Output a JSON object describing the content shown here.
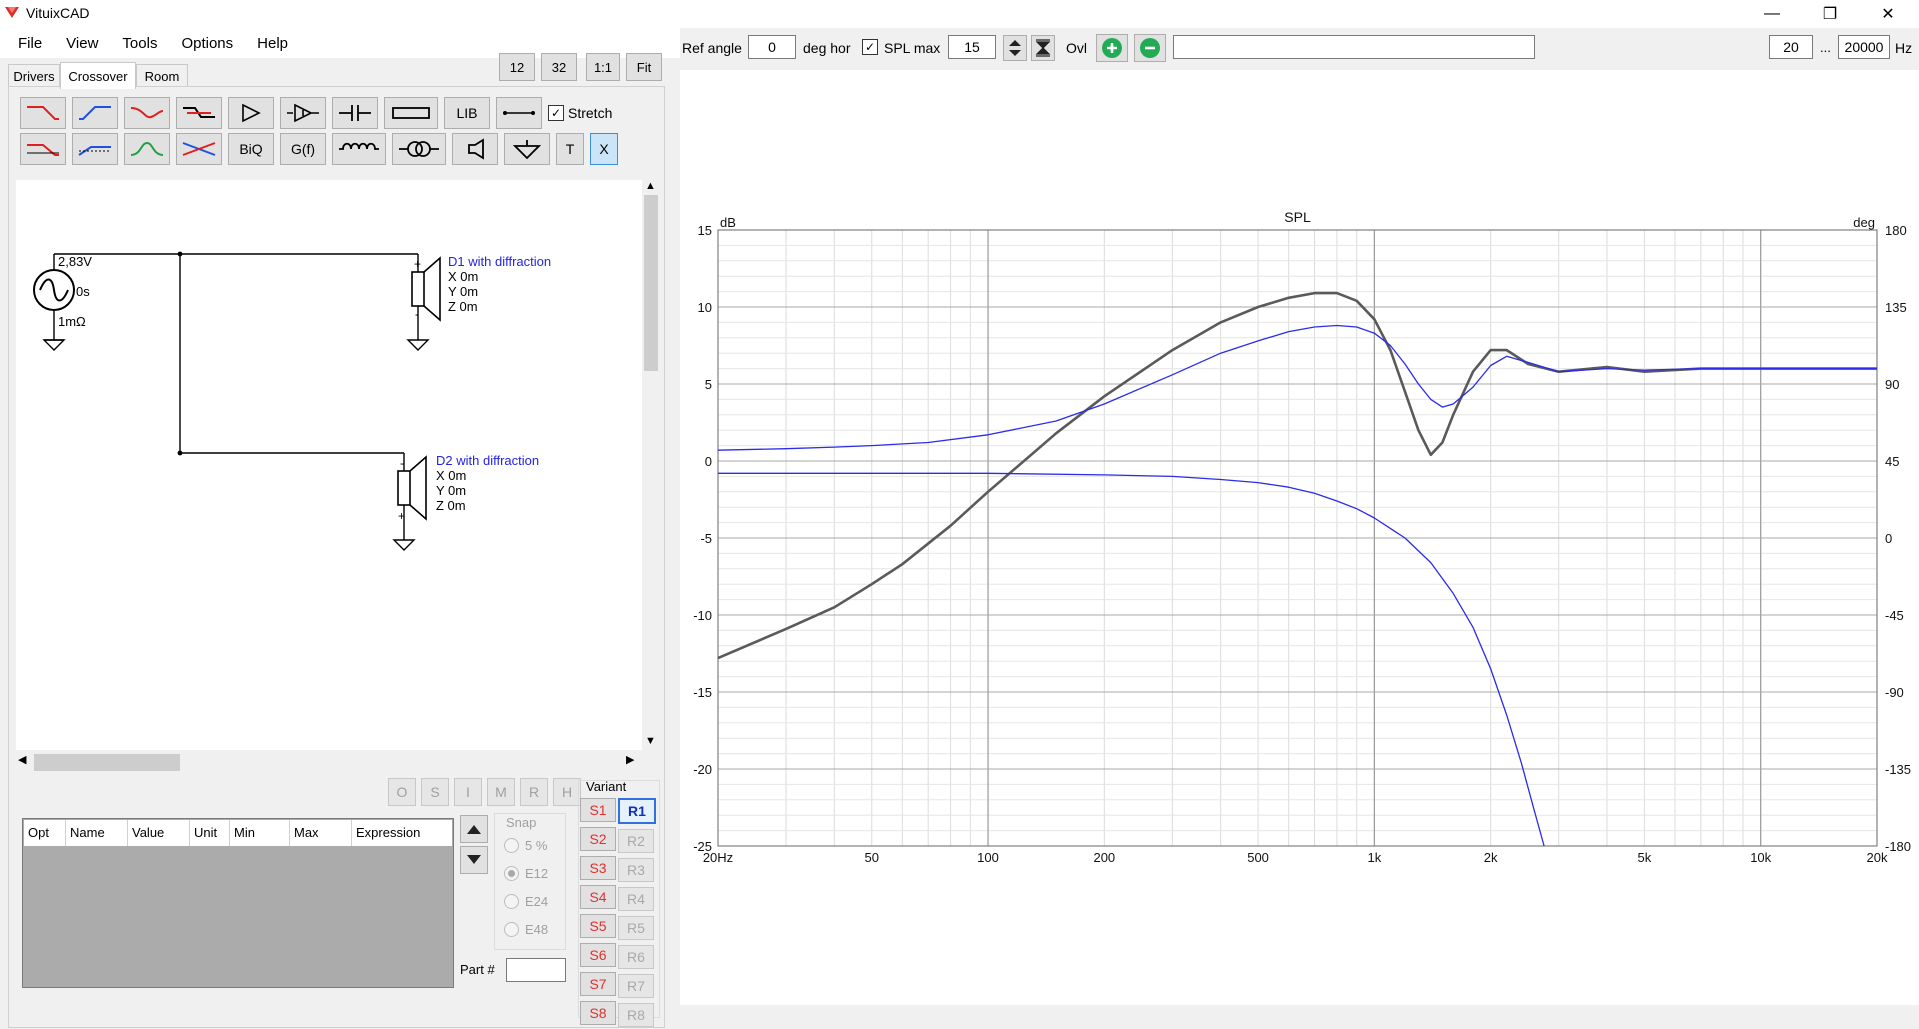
{
  "window": {
    "title": "VituixCAD",
    "controls": {
      "minimize": "—",
      "restore": "❐",
      "close": "✕"
    }
  },
  "menu": [
    "File",
    "View",
    "Tools",
    "Options",
    "Help"
  ],
  "tabs": [
    "Drivers",
    "Crossover",
    "Room"
  ],
  "active_tab": "Crossover",
  "zoom_buttons": [
    "12",
    "32",
    "1:1",
    "Fit"
  ],
  "toolbar": {
    "lib_label": "LIB",
    "biq_label": "BiQ",
    "gf_label": "G(f)",
    "t_label": "T",
    "x_label": "X",
    "stretch_label": "Stretch",
    "stretch_checked": true
  },
  "schematic": {
    "source": {
      "voltage": "2,83V",
      "delay": "0s",
      "resistance": "1mΩ"
    },
    "drivers": [
      {
        "name": "D1 with diffraction",
        "x": "X 0m",
        "y": "Y 0m",
        "z": "Z 0m"
      },
      {
        "name": "D2 with diffraction",
        "x": "X 0m",
        "y": "Y 0m",
        "z": "Z 0m"
      }
    ]
  },
  "parts_buttons": [
    "O",
    "S",
    "I",
    "M",
    "R",
    "H"
  ],
  "parts_table": {
    "columns": [
      "Opt",
      "Name",
      "Value",
      "Unit",
      "Min",
      "Max",
      "Expression"
    ]
  },
  "snap": {
    "label": "Snap",
    "options": [
      "5 %",
      "E12",
      "E24",
      "E48"
    ],
    "selected": "E12"
  },
  "part_number_label": "Part #",
  "variant": {
    "label": "Variant",
    "s_buttons": [
      "S1",
      "S2",
      "S3",
      "S4",
      "S5",
      "S6",
      "S7",
      "S8"
    ],
    "r_buttons": [
      "R1",
      "R2",
      "R3",
      "R4",
      "R5",
      "R6",
      "R7",
      "R8"
    ],
    "selected": "R1"
  },
  "top_controls": {
    "ref_angle_label": "Ref angle",
    "ref_angle_value": "0",
    "deg_hor_label": "deg hor",
    "spl_max_label": "SPL max",
    "spl_max_checked": true,
    "spl_max_value": "15",
    "ovl_label": "Ovl",
    "freq_min": "20",
    "freq_sep": "...",
    "freq_max": "20000",
    "freq_unit": "Hz"
  },
  "colors": {
    "total_curve": "#5a5a5a",
    "driver_curves": "#2b2bea",
    "plus_button": "#22aa55",
    "minus_button": "#22aa55"
  },
  "chart_data": {
    "type": "line",
    "title": "SPL",
    "ylabel_left": "dB",
    "ylabel_right": "deg",
    "x_scale": "log",
    "xlim": [
      20,
      20000
    ],
    "ylim": [
      -25,
      15
    ],
    "y2lim": [
      -180,
      180
    ],
    "grid": true,
    "x_tick_labels": [
      "20Hz",
      "50",
      "100",
      "200",
      "500",
      "1k",
      "2k",
      "5k",
      "10k",
      "20k"
    ],
    "x_tick_values": [
      20,
      50,
      100,
      200,
      500,
      1000,
      2000,
      5000,
      10000,
      20000
    ],
    "y_tick_values": [
      15,
      10,
      5,
      0,
      -5,
      -10,
      -15,
      -20,
      -25
    ],
    "y2_tick_values": [
      180,
      135,
      90,
      45,
      0,
      -45,
      -90,
      -135,
      -180
    ],
    "series": [
      {
        "color": "#5a5a5a",
        "x": [
          20,
          30,
          40,
          50,
          60,
          80,
          100,
          120,
          150,
          200,
          300,
          400,
          500,
          600,
          700,
          800,
          900,
          1000,
          1100,
          1200,
          1300,
          1400,
          1500,
          1600,
          1800,
          2000,
          2200,
          2500,
          3000,
          4000,
          5000,
          7000,
          10000,
          15000,
          20000
        ],
        "y": [
          -12.8,
          -10.9,
          -9.5,
          -8.0,
          -6.7,
          -4.2,
          -2.0,
          -0.3,
          1.8,
          4.2,
          7.2,
          9.0,
          10.0,
          10.6,
          10.9,
          10.9,
          10.4,
          9.2,
          7.2,
          4.5,
          2.0,
          0.4,
          1.2,
          3.0,
          5.8,
          7.2,
          7.2,
          6.3,
          5.8,
          6.1,
          5.8,
          6.0,
          6.0,
          6.0,
          6.0
        ]
      },
      {
        "color": "#2b2bea",
        "x": [
          20,
          30,
          40,
          50,
          70,
          100,
          150,
          200,
          300,
          400,
          500,
          600,
          700,
          800,
          900,
          1000,
          1100,
          1200,
          1300,
          1400,
          1500,
          1600,
          1800,
          2000,
          2200,
          2500,
          3000,
          4000,
          5000,
          7000,
          10000,
          15000,
          20000
        ],
        "y": [
          0.7,
          0.8,
          0.9,
          1.0,
          1.2,
          1.7,
          2.6,
          3.7,
          5.6,
          7.0,
          7.8,
          8.4,
          8.7,
          8.8,
          8.7,
          8.3,
          7.5,
          6.3,
          5.0,
          4.0,
          3.5,
          3.7,
          4.8,
          6.2,
          6.8,
          6.4,
          5.8,
          6.0,
          5.9,
          6.0,
          6.0,
          6.0,
          6.0
        ]
      },
      {
        "color": "#2b2bea",
        "x": [
          20,
          50,
          100,
          200,
          300,
          400,
          500,
          600,
          700,
          800,
          900,
          1000,
          1200,
          1400,
          1600,
          1800,
          2000,
          2200,
          2400,
          2600,
          2750
        ],
        "y": [
          -0.8,
          -0.8,
          -0.8,
          -0.9,
          -1.0,
          -1.2,
          -1.4,
          -1.7,
          -2.1,
          -2.6,
          -3.1,
          -3.7,
          -5.0,
          -6.6,
          -8.6,
          -10.8,
          -13.5,
          -16.5,
          -19.6,
          -22.8,
          -25
        ]
      }
    ]
  }
}
